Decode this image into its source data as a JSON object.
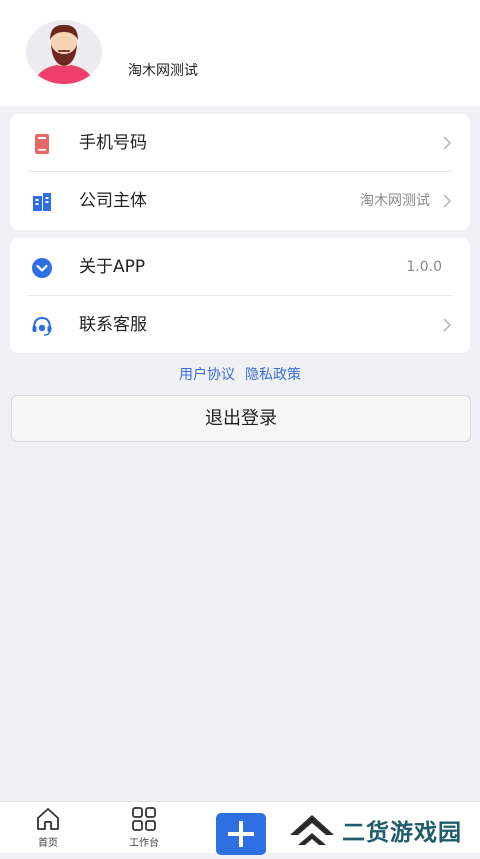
{
  "profile": {
    "name": "淘木网测试"
  },
  "card1": {
    "rows": [
      {
        "label": "手机号码",
        "value": "",
        "icon": "phone-book-icon",
        "color": "#e8686a"
      },
      {
        "label": "公司主体",
        "value": "淘木网测试",
        "icon": "building-icon",
        "color": "#2f6fe4"
      }
    ]
  },
  "card2": {
    "rows": [
      {
        "label": "关于APP",
        "value": "1.0.0",
        "icon": "chevron-circle-icon",
        "color": "#2f6fe4"
      },
      {
        "label": "联系客服",
        "value": "",
        "icon": "headset-icon",
        "color": "#2f6fe4"
      }
    ]
  },
  "links": {
    "user_agreement": "用户协议",
    "privacy_policy": "隐私政策"
  },
  "logout_label": "退出登录",
  "tabbar": {
    "home": "首页",
    "workbench": "工作台"
  },
  "watermark": {
    "text": "二货游戏园"
  },
  "colors": {
    "accent": "#2f6fe4",
    "link": "#3a6fd8",
    "background": "#f0f0f5"
  }
}
